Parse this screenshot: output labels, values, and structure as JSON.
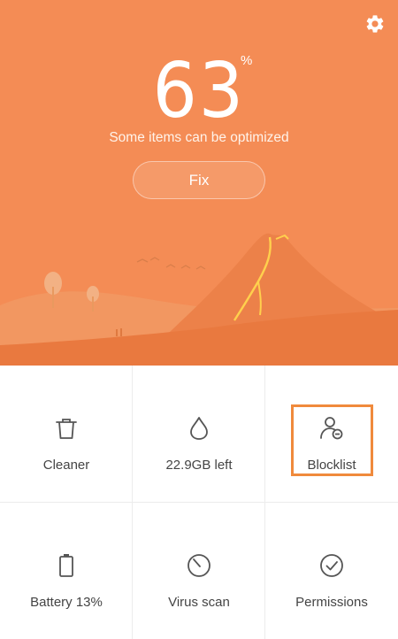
{
  "header": {
    "settings_icon": "gear-icon",
    "score_value": "63",
    "score_unit": "%",
    "subtitle": "Some items can be optimized",
    "fix_label": "Fix"
  },
  "colors": {
    "hero_background": "#f48c55",
    "accent_outline": "#f08a3c",
    "label_text": "#444444",
    "icon_stroke": "#555555"
  },
  "tools": [
    {
      "label": "Cleaner",
      "icon": "trash-icon"
    },
    {
      "label": "22.9GB left",
      "icon": "water-drop-icon"
    },
    {
      "label": "Blocklist",
      "icon": "user-block-icon",
      "highlighted": true
    },
    {
      "label": "Battery 13%",
      "icon": "battery-icon"
    },
    {
      "label": "Virus scan",
      "icon": "scan-timer-icon"
    },
    {
      "label": "Permissions",
      "icon": "check-circle-icon"
    }
  ]
}
